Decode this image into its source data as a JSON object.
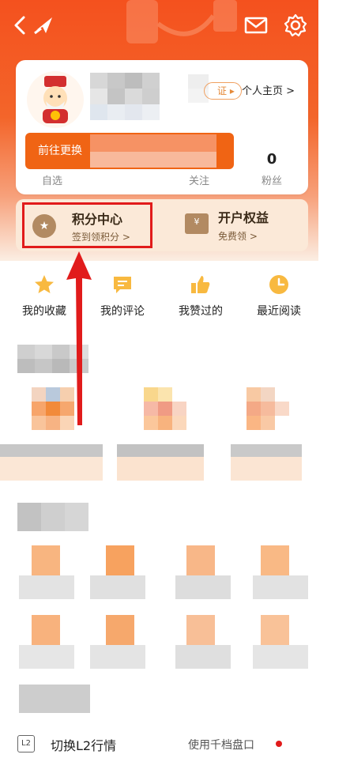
{
  "header": {
    "back_icon": "chevron-left-icon",
    "logo_icon": "brand-logo-icon",
    "mail_icon": "envelope-icon",
    "settings_icon": "gear-icon"
  },
  "profile": {
    "verify_badge": "证 ▸",
    "home_link": "个人主页 >",
    "tooltip": "前往更换",
    "stats": [
      {
        "label": "自选",
        "value": ""
      },
      {
        "label": "关注",
        "value": ""
      },
      {
        "label": "粉丝",
        "value": "0"
      }
    ]
  },
  "quick_entries": {
    "points": {
      "title": "积分中心",
      "subtitle": "签到领积分 >"
    },
    "account": {
      "title": "开户权益",
      "subtitle": "免费领 >"
    }
  },
  "shortcuts": [
    {
      "label": "我的收藏",
      "icon": "star-icon"
    },
    {
      "label": "我的评论",
      "icon": "comment-icon"
    },
    {
      "label": "我赞过的",
      "icon": "thumbs-up-icon"
    },
    {
      "label": "最近阅读",
      "icon": "clock-icon"
    }
  ],
  "bottom_bar": {
    "l2_icon_text": "L2",
    "l2_label": "切换L2行情",
    "depth_label": "使用千档盘口"
  },
  "colors": {
    "brand_orange": "#f4511e",
    "highlight_red": "#e11b1b",
    "tooltip_orange": "#f06414",
    "entry_bg": "#fbe9d8"
  }
}
